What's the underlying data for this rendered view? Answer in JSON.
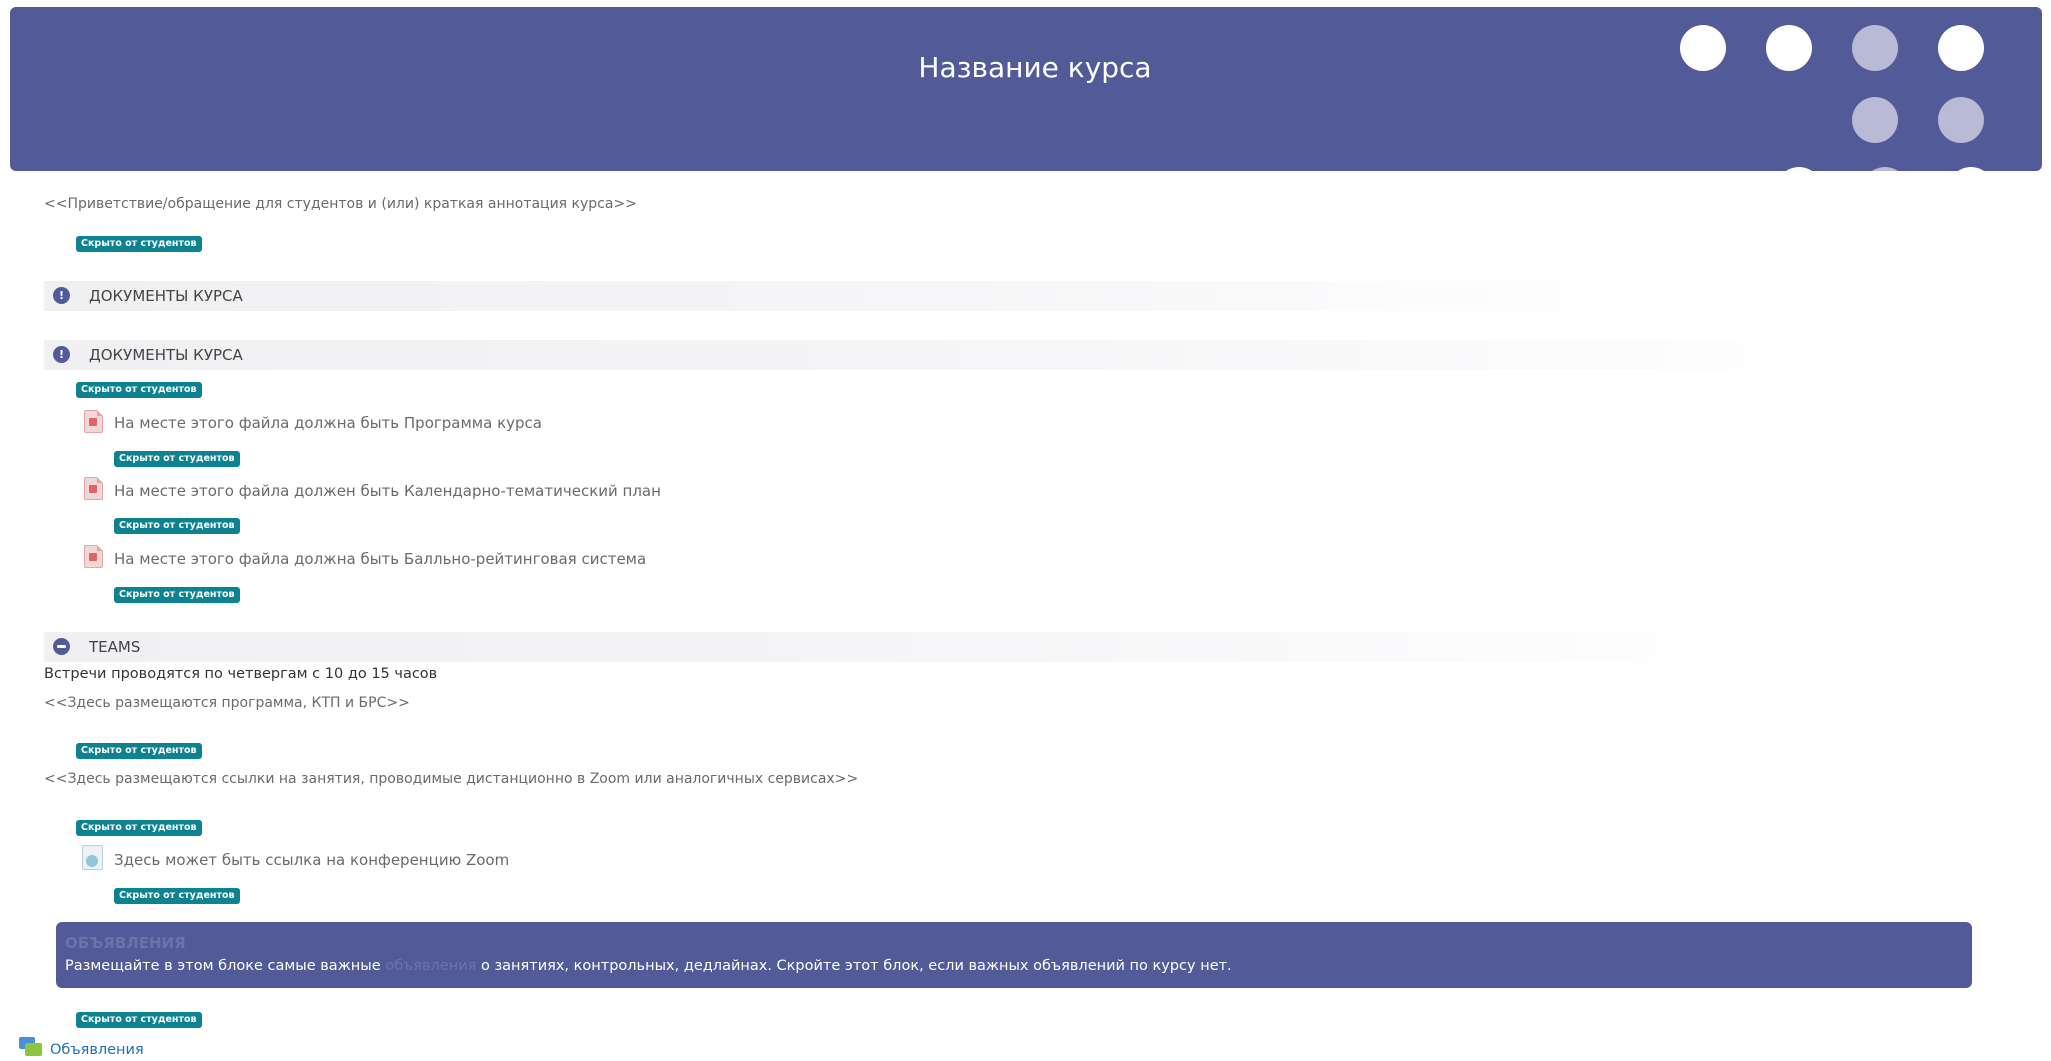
{
  "header": {
    "title": "Название курса"
  },
  "intro": {
    "text": "<<Приветствие/обращение для студентов и (или) краткая аннотация курса>>"
  },
  "badge_label": "Скрыто от студентов",
  "sections": [
    {
      "title": "ДОКУМЕНТЫ КУРСА",
      "icon": "exclamation-icon"
    },
    {
      "title": "ДОКУМЕНТЫ КУРСА",
      "icon": "exclamation-icon",
      "files": [
        {
          "name": "На месте этого файла должна быть Программа курса",
          "icon": "pdf-icon"
        },
        {
          "name": "На месте этого файла должен быть Календарно-тематический план",
          "icon": "pdf-icon"
        },
        {
          "name": "На месте этого файла должна быть Балльно-рейтинговая система",
          "icon": "pdf-icon"
        }
      ]
    },
    {
      "title": "TEAMS",
      "icon": "minus-circle-icon",
      "description": "Встречи проводятся по четвергам с 10 до 15 часов",
      "labels": [
        "<<Здесь размещаются программа, КТП и БРС>>",
        "<<Здесь размещаются ссылки на занятия, проводимые дистанционно в Zoom или аналогичных сервисах>>"
      ],
      "link": {
        "name": "Здесь может быть ссылка на конференцию Zoom",
        "icon": "url-icon"
      }
    }
  ],
  "announcement": {
    "title": "ОБЪЯВЛЕНИЯ",
    "text_before": "Размещайте в этом блоке самые важные ",
    "text_faded": "объявления",
    "text_after": " о занятиях, контрольных, дедлайнах. Скройте этот блок, если важных объявлений по курсу нет."
  },
  "forum": {
    "label": "Объявления",
    "icon": "forum-icon"
  },
  "colors": {
    "header_bg": "#525b98",
    "badge_bg": "#0d8290",
    "link": "#1f6fb6"
  }
}
